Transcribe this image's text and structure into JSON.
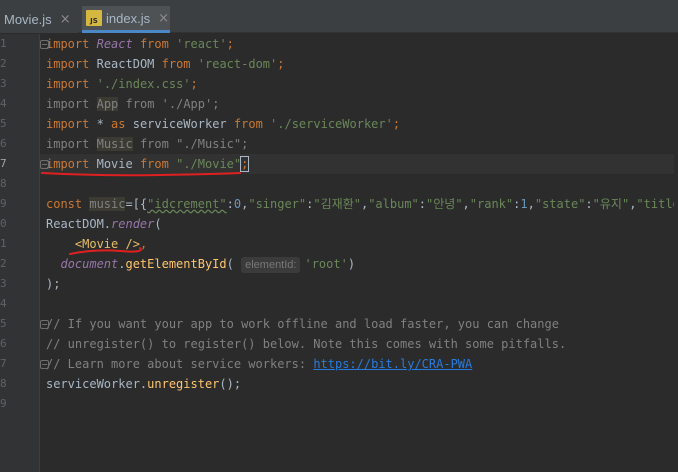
{
  "tabs": [
    {
      "label": "Movie.js",
      "close": "×",
      "icon": "js-file-icon"
    },
    {
      "label": "index.js",
      "close": "×",
      "icon": "js-file-icon",
      "active": true
    }
  ],
  "gutter": {
    "line_numbers": [
      "1",
      "2",
      "3",
      "4",
      "5",
      "6",
      "7",
      "8",
      "9",
      "0",
      "1",
      "2",
      "3",
      "4",
      "5",
      "6",
      "7",
      "8",
      "9"
    ],
    "current_index": 6
  },
  "code": {
    "l1": {
      "kw": "import",
      "name": "React",
      "from": "from",
      "path": "'react'",
      "semi": ";"
    },
    "l2": {
      "kw": "import",
      "name": "ReactDOM",
      "from": "from",
      "path": "'react-dom'",
      "semi": ";"
    },
    "l3": {
      "kw": "import",
      "path": "'./index.css'",
      "semi": ";"
    },
    "l4": {
      "kw": "import",
      "name": "App",
      "from": "from",
      "path": "'./App'",
      "semi": ";"
    },
    "l5": {
      "kw": "import",
      "star": "* ",
      "as": "as",
      "name": "serviceWorker",
      "from": "from",
      "path": "'./serviceWorker'",
      "semi": ";"
    },
    "l6": {
      "kw": "import",
      "name": "Music",
      "from": "from",
      "path": "\"./Music\"",
      "semi": ";"
    },
    "l7": {
      "kw": "import",
      "name": "Movie",
      "from": "from",
      "path": "\"./Movie\"",
      "semi": ";"
    },
    "l9": {
      "const": "const",
      "name": "music",
      "eq": "=[{",
      "k1": "\"idcrement\"",
      "v1": "0",
      "k2": "\"singer\"",
      "v2": "\"김재환\"",
      "k3": "\"album\"",
      "v3": "\"안녕\"",
      "k4": "\"rank\"",
      "v4": "1",
      "k5": "\"state\"",
      "v5": "\"유지\"",
      "k6": "\"title\""
    },
    "l10": {
      "obj": "ReactDOM",
      "method": "render",
      "paren": "("
    },
    "l11": {
      "tag": "<Movie />",
      "comma": ","
    },
    "l12": {
      "obj": "document",
      "method": "getElementById",
      "paren": "(",
      "hint": "elementId:",
      "arg": "'root'",
      "close": ")"
    },
    "l13": {
      "text": ");"
    },
    "l15": {
      "text": "// If you want your app to work offline and load faster, you can change"
    },
    "l16": {
      "text": "// unregister() to register() below. Note this comes with some pitfalls."
    },
    "l17": {
      "text": "// Learn more about service workers: ",
      "link": "https://bit.ly/CRA-PWA"
    },
    "l18": {
      "obj": "serviceWorker",
      "method": "unregister",
      "tail": "();"
    }
  },
  "colors": {
    "background": "#2b2b2b",
    "gutter": "#313335",
    "keyword": "#cc7832",
    "string": "#6a8759",
    "number": "#6897bb",
    "comment": "#808080",
    "red_annotation": "#e02020"
  }
}
